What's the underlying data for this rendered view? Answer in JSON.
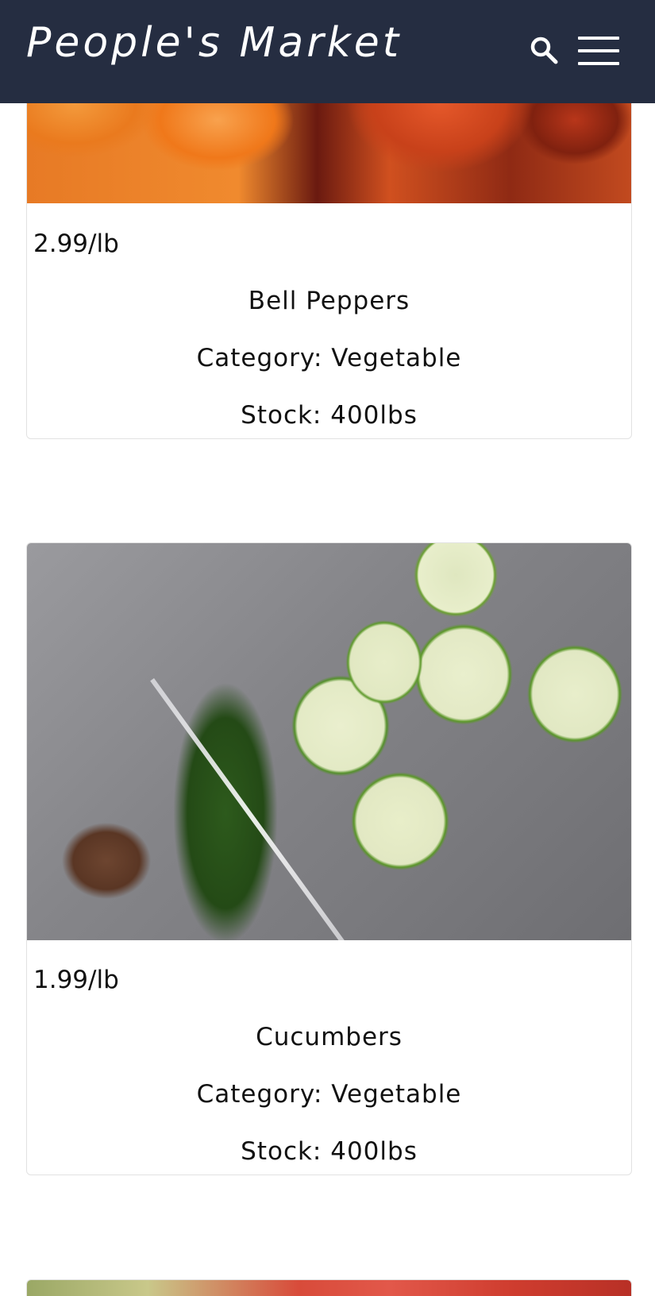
{
  "header": {
    "brand": "People's Market",
    "search_icon": "search-icon",
    "menu_icon": "hamburger-menu-icon",
    "background": "#252d41"
  },
  "products": [
    {
      "image": "bell-peppers-photo",
      "price": "2.99/lb",
      "name": "Bell Peppers",
      "category": "Category: Vegetable",
      "stock": "Stock: 400lbs"
    },
    {
      "image": "cucumbers-photo",
      "price": "1.99/lb",
      "name": "Cucumbers",
      "category": "Category: Vegetable",
      "stock": "Stock: 400lbs"
    },
    {
      "image": "tomatoes-photo"
    }
  ]
}
